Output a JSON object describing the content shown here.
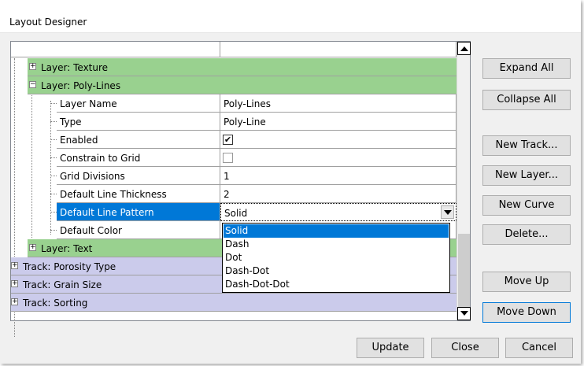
{
  "window": {
    "title": "Layout Designer"
  },
  "tree": {
    "rows": [
      {
        "kind": "layer",
        "label": "Layer: Texture"
      },
      {
        "kind": "layer",
        "label": "Layer: Poly-Lines"
      },
      {
        "kind": "layer",
        "label": "Layer: Text"
      },
      {
        "kind": "track",
        "label": "Track: Porosity Type"
      },
      {
        "kind": "track",
        "label": "Track: Grain Size"
      },
      {
        "kind": "track",
        "label": "Track: Sorting"
      }
    ],
    "expander_symbols": {
      "plus": "+",
      "minus": "−"
    },
    "properties": [
      {
        "name": "Layer Name",
        "value": "Poly-Lines"
      },
      {
        "name": "Type",
        "value": "Poly-Line"
      },
      {
        "name": "Enabled",
        "value": "✔"
      },
      {
        "name": "Constrain to Grid",
        "value": ""
      },
      {
        "name": "Grid Divisions",
        "value": "1"
      },
      {
        "name": "Default Line Thickness",
        "value": "2"
      },
      {
        "name": "Default Line Pattern",
        "value": "Solid"
      },
      {
        "name": "Default Color",
        "value": ""
      }
    ],
    "line_pattern_dropdown": {
      "selected": "Solid",
      "options": [
        "Solid",
        "Dash",
        "Dot",
        "Dash-Dot",
        "Dash-Dot-Dot"
      ]
    }
  },
  "side_buttons": {
    "expand_all": "Expand All",
    "collapse_all": "Collapse All",
    "new_track": "New Track...",
    "new_layer": "New Layer...",
    "new_curve": "New Curve",
    "delete": "Delete...",
    "move_up": "Move Up",
    "move_down": "Move Down"
  },
  "footer_buttons": {
    "update": "Update",
    "close": "Close",
    "cancel": "Cancel"
  },
  "colors": {
    "layer_row": "#99d18f",
    "track_row": "#cbcbeb",
    "selection": "#0078d7"
  },
  "icons": {
    "expander": "plus-minus-box-icon",
    "checkbox": "checkbox-icon",
    "dropdown": "chevron-down-icon",
    "scroll_up": "scroll-up-arrow-icon",
    "scroll_down": "scroll-down-arrow-icon"
  }
}
